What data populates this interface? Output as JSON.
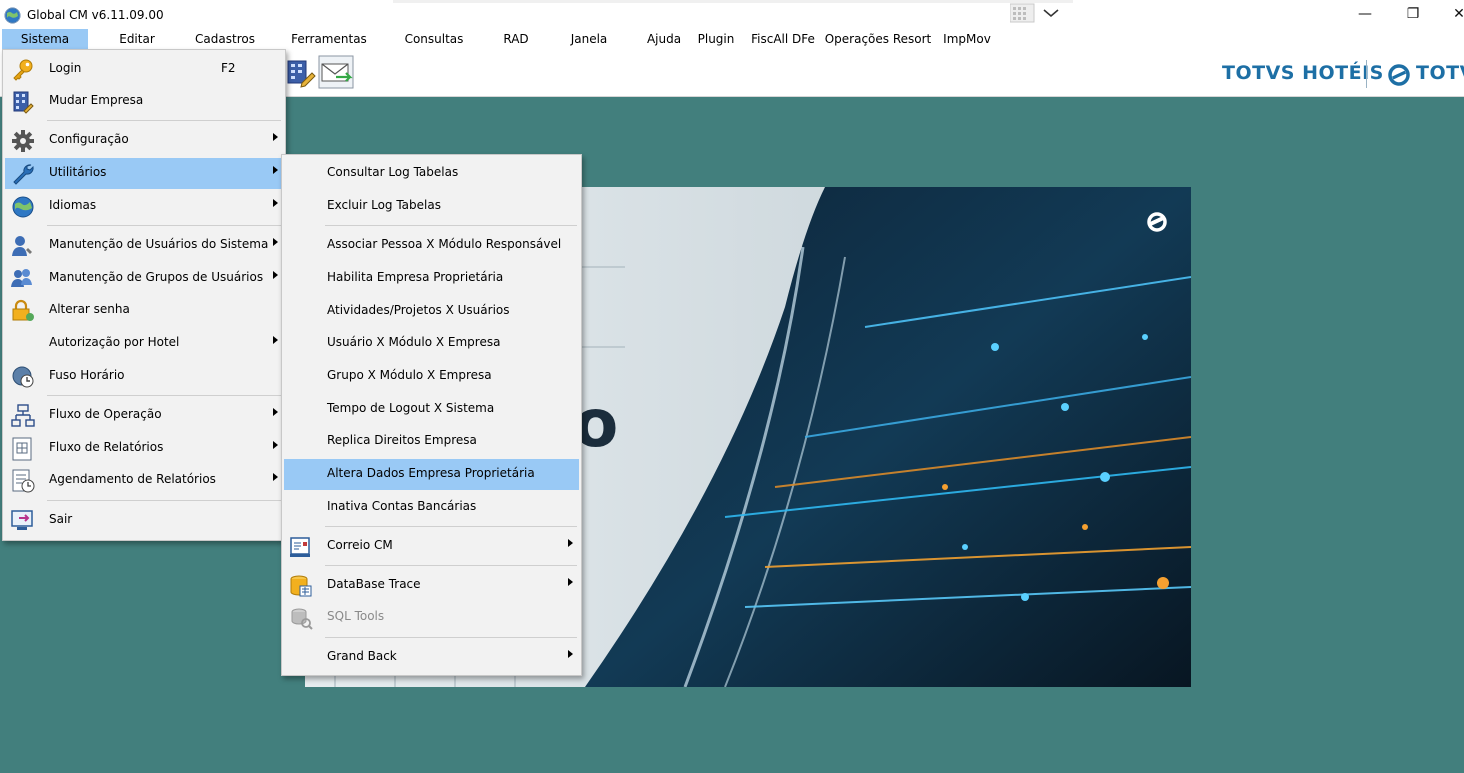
{
  "window": {
    "title": "Global CM v6.11.09.00"
  },
  "titlebar": {
    "minimize": "—",
    "restore": "❐",
    "close": "✕"
  },
  "menubar": {
    "items": [
      "Sistema",
      "Editar",
      "Cadastros",
      "Ferramentas",
      "Consultas",
      "RAD",
      "Janela",
      "Ajuda",
      "Plugin",
      "FiscAll DFe",
      "Operações Resort",
      "ImpMov"
    ],
    "active": "Sistema"
  },
  "brand": {
    "left": "TOTVS HOTÉIS",
    "right": "TOTVS"
  },
  "hero": {
    "letter": "o"
  },
  "sistema_menu": [
    {
      "label": "Login",
      "shortcut": "F2",
      "icon": "key-icon"
    },
    {
      "label": "Mudar Empresa",
      "icon": "building-icon"
    },
    {
      "label": "Configuração",
      "icon": "gear-icon",
      "submenu": true
    },
    {
      "label": "Utilitários",
      "icon": "wrench-icon",
      "submenu": true,
      "highlighted": true
    },
    {
      "label": "Idiomas",
      "icon": "globe-icon",
      "submenu": true
    },
    {
      "label": "Manutenção de Usuários do Sistema",
      "icon": "user-config-icon",
      "submenu": true
    },
    {
      "label": "Manutenção de Grupos de Usuários",
      "icon": "users-group-icon",
      "submenu": true
    },
    {
      "label": "Alterar senha",
      "icon": "lock-icon"
    },
    {
      "label": "Autorização por Hotel",
      "submenu": true
    },
    {
      "label": "Fuso Horário",
      "icon": "clock-globe-icon"
    },
    {
      "label": "Fluxo de Operação",
      "icon": "flowchart-icon",
      "submenu": true
    },
    {
      "label": "Fluxo de Relatórios",
      "icon": "report-icon",
      "submenu": true
    },
    {
      "label": "Agendamento de Relatórios",
      "icon": "report-schedule-icon",
      "submenu": true
    },
    {
      "label": "Sair",
      "icon": "exit-icon"
    }
  ],
  "utilitarios_menu": [
    {
      "label": "Consultar Log Tabelas"
    },
    {
      "label": "Excluir Log Tabelas"
    },
    {
      "label": "Associar Pessoa X Módulo Responsável"
    },
    {
      "label": "Habilita Empresa Proprietária"
    },
    {
      "label": "Atividades/Projetos X Usuários"
    },
    {
      "label": "Usuário X Módulo X Empresa"
    },
    {
      "label": "Grupo X Módulo X Empresa"
    },
    {
      "label": "Tempo de Logout X Sistema"
    },
    {
      "label": "Replica Direitos Empresa"
    },
    {
      "label": "Altera Dados Empresa Proprietária",
      "highlighted": true
    },
    {
      "label": "Inativa Contas Bancárias"
    },
    {
      "label": "Correio CM",
      "icon": "mail-doc-icon",
      "submenu": true
    },
    {
      "label": "DataBase Trace",
      "icon": "database-icon",
      "submenu": true
    },
    {
      "label": "SQL Tools",
      "icon": "sql-tools-icon",
      "disabled": true
    },
    {
      "label": "Grand Back",
      "submenu": true
    }
  ],
  "colors": {
    "workspace": "#427f7d",
    "highlight": "#99c9f5",
    "menu_bg": "#f2f2f2",
    "brand": "#1d6fa5"
  }
}
